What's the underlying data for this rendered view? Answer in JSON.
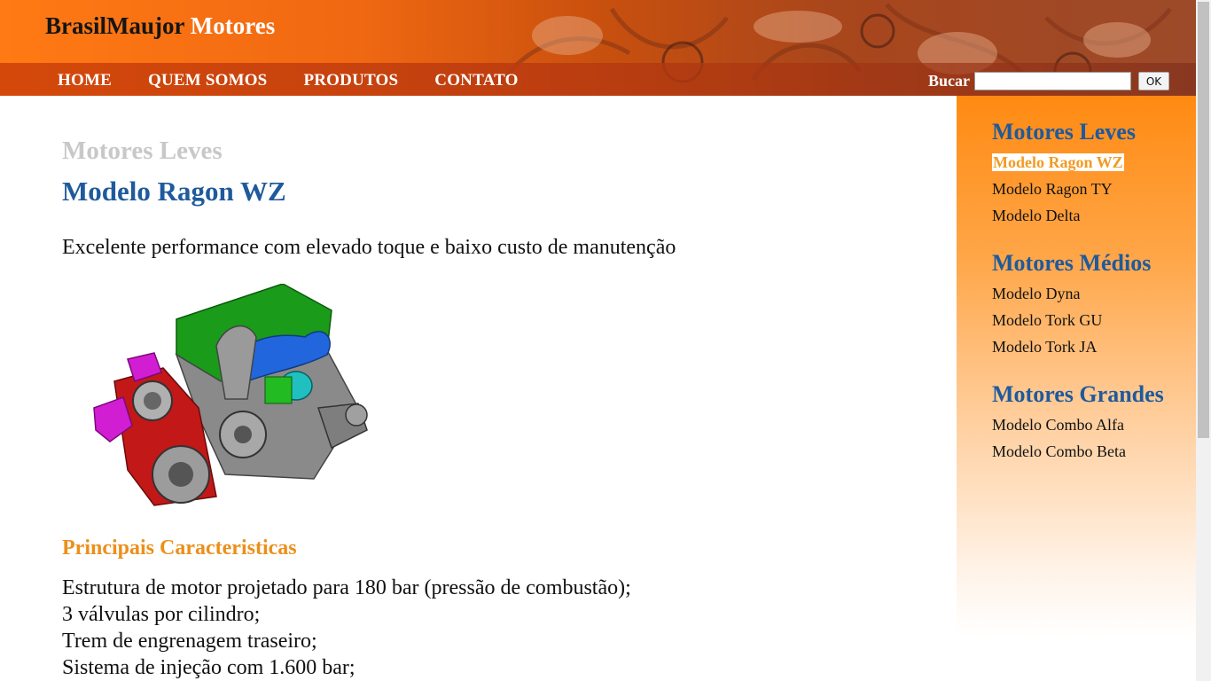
{
  "header": {
    "brand_part1": "BrasilMaujor",
    "brand_part2": "Motores",
    "nav": [
      "HOME",
      "QUEM SOMOS",
      "PRODUTOS",
      "CONTATO"
    ],
    "search_label": "Bucar",
    "search_value": "",
    "search_button": "OK"
  },
  "main": {
    "category": "Motores Leves",
    "model": "Modelo Ragon WZ",
    "tagline": "Excelente performance com elevado toque e baixo custo de manutenção",
    "features_title": "Principais Caracteristicas",
    "features": [
      "Estrutura de motor projetado para 180 bar (pressão de combustão);",
      "3 válvulas por cilindro;",
      "Trem de engrenagem traseiro;",
      "Sistema de injeção com 1.600 bar;"
    ]
  },
  "sidebar": {
    "groups": [
      {
        "title": "Motores Leves",
        "items": [
          "Modelo Ragon WZ",
          "Modelo Ragon TY",
          "Modelo Delta"
        ]
      },
      {
        "title": "Motores Médios",
        "items": [
          "Modelo Dyna",
          "Modelo Tork GU",
          "Modelo Tork JA"
        ]
      },
      {
        "title": "Motores Grandes",
        "items": [
          "Modelo Combo Alfa",
          "Modelo Combo Beta"
        ]
      }
    ],
    "active_item": "Modelo Ragon WZ"
  },
  "colors": {
    "accent_orange": "#ec8f1a",
    "title_blue": "#1f5a9c",
    "category_gray": "#c8c8c8"
  }
}
